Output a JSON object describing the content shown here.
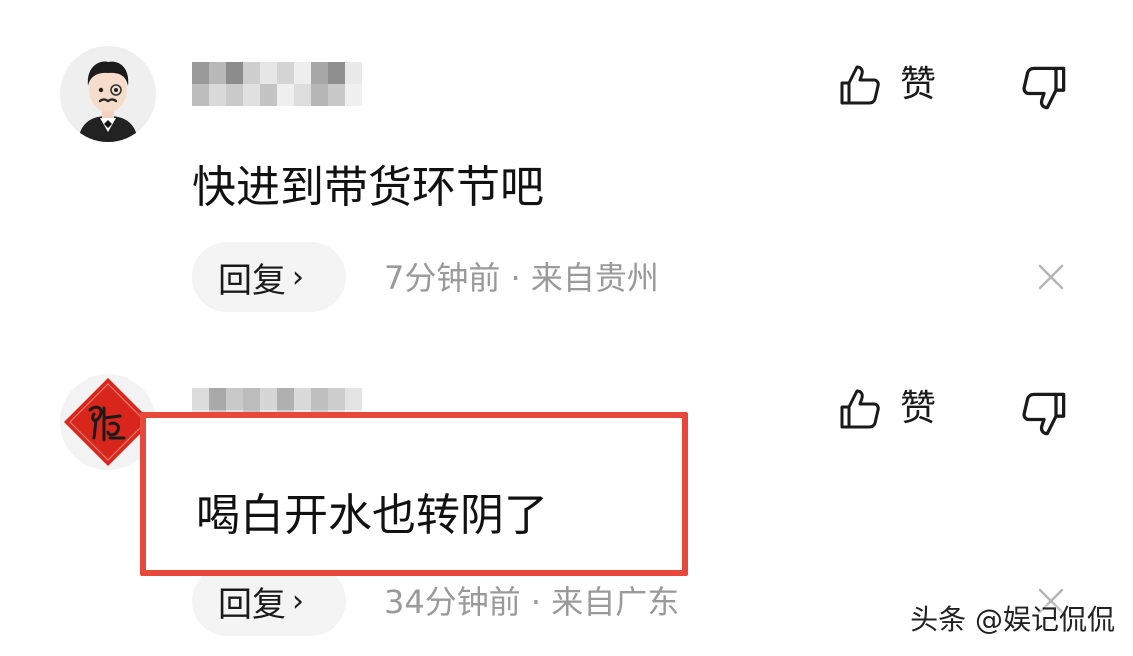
{
  "comments": [
    {
      "like_label": "赞",
      "text": "快进到带货环节吧",
      "reply_label": "回复",
      "reply_chevron": "›",
      "meta": "7分钟前 · 来自贵州"
    },
    {
      "like_label": "赞",
      "text": "喝白开水也转阴了",
      "reply_label": "回复",
      "reply_chevron": "›",
      "meta": "34分钟前 · 来自广东"
    }
  ],
  "highlight": {
    "color": "#e8473c"
  },
  "watermark": "头条 @娱记侃侃",
  "icons": {
    "like": "thumbs-up-icon",
    "dislike": "thumbs-down-icon",
    "close": "close-icon"
  }
}
